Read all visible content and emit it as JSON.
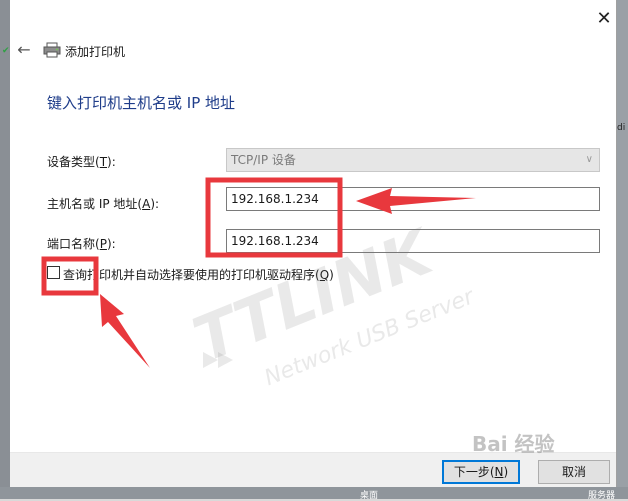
{
  "window": {
    "title": "添加打印机",
    "heading": "键入打印机主机名或 IP 地址",
    "close_glyph": "✕",
    "back_glyph": "←"
  },
  "form": {
    "device_type": {
      "label_prefix": "设备类型(",
      "mnemonic": "T",
      "label_suffix": "):",
      "value": "TCP/IP 设备"
    },
    "hostname": {
      "label_prefix": "主机名或 IP 地址(",
      "mnemonic": "A",
      "label_suffix": "):",
      "value": "192.168.1.234"
    },
    "port_name": {
      "label_prefix": "端口名称(",
      "mnemonic": "P",
      "label_suffix": "):",
      "value": "192.168.1.234"
    },
    "query_printer": {
      "label_prefix": "查询打印机并自动选择要使用的打印机驱动程序(",
      "mnemonic": "Q",
      "label_suffix": ")",
      "checked": false
    }
  },
  "buttons": {
    "next": {
      "prefix": "下一步(",
      "mnemonic": "N",
      "suffix": ")"
    },
    "cancel": {
      "label": "取消"
    }
  },
  "watermark": {
    "brand": "TTLINK",
    "tagline": "Network USB Server",
    "site": "Bai 经验"
  },
  "background": {
    "right_fragment": "di",
    "bottom_left_fragment": "桌面",
    "bottom_right_fragment": "服务器"
  },
  "colors": {
    "heading": "#1f3d8a",
    "accent": "#0078d7",
    "annotation": "#e8383d"
  }
}
